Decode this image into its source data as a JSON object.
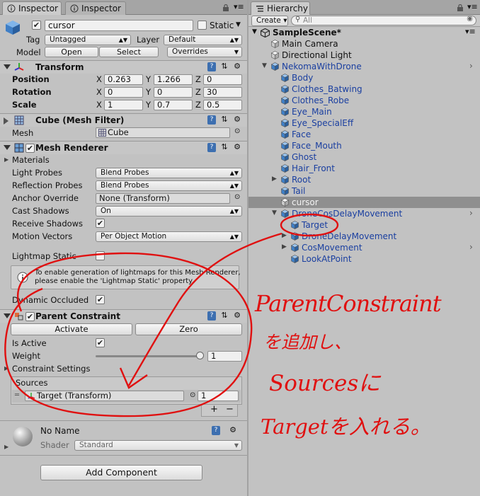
{
  "inspector": {
    "tabs": [
      "Inspector",
      "Inspector"
    ],
    "object_name": "cursor",
    "static_label": "Static",
    "tag_label": "Tag",
    "tag_value": "Untagged",
    "layer_label": "Layer",
    "layer_value": "Default",
    "model_label": "Model",
    "model_open": "Open",
    "model_select": "Select",
    "model_overrides": "Overrides",
    "transform": {
      "title": "Transform",
      "rows": [
        {
          "label": "Position",
          "x": "0.263",
          "y": "1.266",
          "z": "0"
        },
        {
          "label": "Rotation",
          "x": "0",
          "y": "0",
          "z": "30"
        },
        {
          "label": "Scale",
          "x": "1",
          "y": "0.7",
          "z": "0.5"
        }
      ],
      "axes": [
        "X",
        "Y",
        "Z"
      ]
    },
    "mesh_filter": {
      "title": "Cube (Mesh Filter)",
      "mesh_label": "Mesh",
      "mesh_value": "Cube"
    },
    "mesh_renderer": {
      "title": "Mesh Renderer",
      "materials": "Materials",
      "light_probes_label": "Light Probes",
      "light_probes_value": "Blend Probes",
      "reflection_probes_label": "Reflection Probes",
      "reflection_probes_value": "Blend Probes",
      "anchor_override_label": "Anchor Override",
      "anchor_override_value": "None (Transform)",
      "cast_shadows_label": "Cast Shadows",
      "cast_shadows_value": "On",
      "receive_shadows_label": "Receive Shadows",
      "motion_vectors_label": "Motion Vectors",
      "motion_vectors_value": "Per Object Motion",
      "lightmap_static_label": "Lightmap Static",
      "info_text_1": "To enable generation of lightmaps for this Mesh Renderer,",
      "info_text_2": "please enable the 'Lightmap Static' property.",
      "dynamic_occluded_label": "Dynamic Occluded"
    },
    "parent_constraint": {
      "title": "Parent Constraint",
      "activate": "Activate",
      "zero": "Zero",
      "is_active_label": "Is Active",
      "weight_label": "Weight",
      "weight_value": "1",
      "weight_fraction": 1.0,
      "constraint_settings": "Constraint Settings",
      "sources_label": "Sources",
      "source_value": "Target (Transform)",
      "source_weight": "1",
      "add": "+",
      "remove": "−"
    },
    "material": {
      "name": "No Name",
      "shader_label": "Shader",
      "shader_value": "Standard"
    },
    "add_component": "Add Component"
  },
  "hierarchy": {
    "tab": "Hierarchy",
    "create": "Create ▾",
    "search_placeholder": "All",
    "scene": "SampleScene*",
    "items": [
      {
        "label": "Main Camera",
        "prefab": false
      },
      {
        "label": "Directional Light",
        "prefab": false
      },
      {
        "label": "NekomaWithDrone",
        "prefab": true
      },
      {
        "label": "Body",
        "prefab": true
      },
      {
        "label": "Clothes_Batwing",
        "prefab": true
      },
      {
        "label": "Clothes_Robe",
        "prefab": true
      },
      {
        "label": "Eye_Main",
        "prefab": true
      },
      {
        "label": "Eye_SpecialEff",
        "prefab": true
      },
      {
        "label": "Face",
        "prefab": true
      },
      {
        "label": "Face_Mouth",
        "prefab": true
      },
      {
        "label": "Ghost",
        "prefab": true
      },
      {
        "label": "Hair_Front",
        "prefab": true
      },
      {
        "label": "Root",
        "prefab": true
      },
      {
        "label": "Tail",
        "prefab": true
      },
      {
        "label": "cursor",
        "prefab": false
      },
      {
        "label": "DroneCosDelayMovement",
        "prefab": true
      },
      {
        "label": "Target",
        "prefab": true
      },
      {
        "label": "DroneDelayMovement",
        "prefab": true
      },
      {
        "label": "CosMovement",
        "prefab": true
      },
      {
        "label": "LookAtPoint",
        "prefab": true
      }
    ]
  },
  "annotation": {
    "line1": "ParentConstraint",
    "line2": "を追加し、",
    "line3": "Sourcesに",
    "line4": "Targetを入れる。",
    "color": "#e01010"
  }
}
